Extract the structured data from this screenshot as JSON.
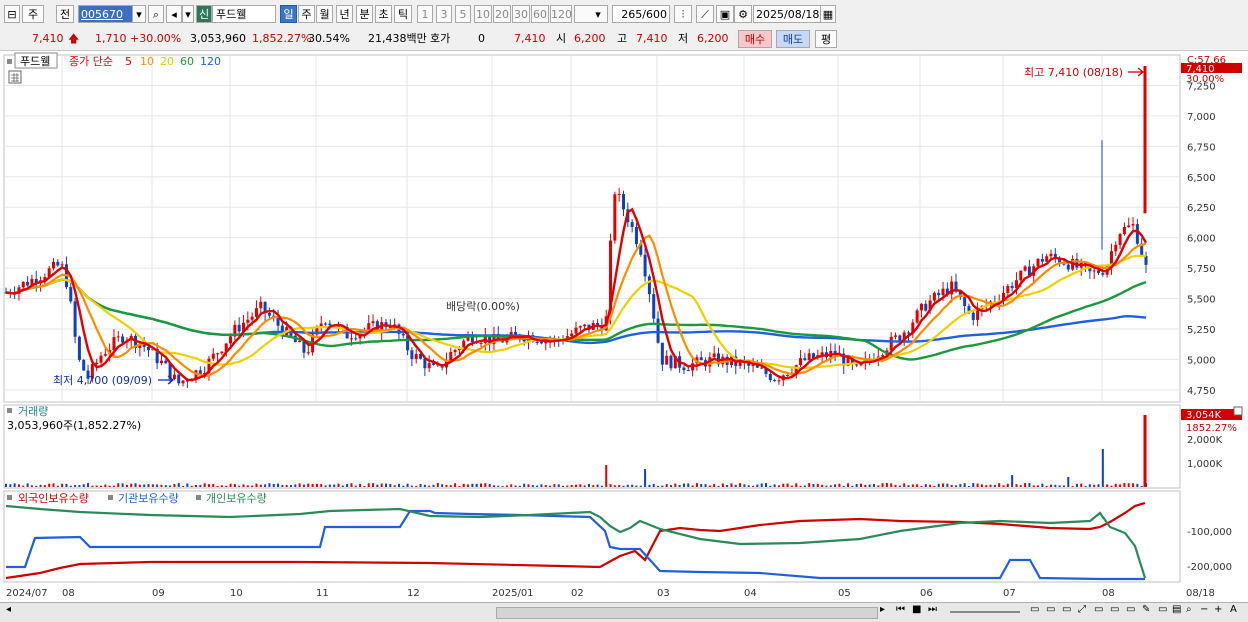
{
  "toolbar": {
    "market": "주",
    "prev_label": "전",
    "stock_code": "005670",
    "new_badge": "신",
    "stock_name": "푸드웰",
    "periods": [
      "일",
      "주",
      "월",
      "년",
      "분",
      "초",
      "틱"
    ],
    "active_period": "일",
    "intervals": [
      "1",
      "3",
      "5",
      "10",
      "20",
      "30",
      "60",
      "120"
    ],
    "count": "265",
    "count_total": "/600",
    "date": "2025/08/18"
  },
  "quote": {
    "price": "7,410",
    "change": "1,710",
    "change_pct": "+30.00%",
    "volume": "3,053,960",
    "volume_ratio": "1,852.27%",
    "turnover": "30.54%",
    "amount": "21,438백만",
    "hoga_label": "호가",
    "hoga_value": "0",
    "hoga_price": "7,410",
    "open_label": "시",
    "open": "6,200",
    "high_label": "고",
    "high": "7,410",
    "low_label": "저",
    "low": "6,200",
    "buy_button": "매수",
    "sell_button": "매도",
    "eval_button": "평"
  },
  "legend": {
    "stock_tag": "푸드웰",
    "ma_prefix": "종가 단순",
    "ma_periods": [
      "5",
      "10",
      "20",
      "60",
      "120"
    ],
    "ma_colors": [
      "#e00000",
      "#ff8c00",
      "#f0d000",
      "#1a9a3a",
      "#2060e0"
    ]
  },
  "annotations": {
    "high_label": "최고 7,410 (08/18)",
    "low_label": "최저 4,700 (09/09)",
    "dividend_label": "배당락(0.00%)"
  },
  "axis": {
    "price_ticks": [
      "7,250",
      "7,000",
      "6,750",
      "6,500",
      "6,250",
      "6,000",
      "5,750",
      "5,500",
      "5,250",
      "5,000",
      "4,750"
    ],
    "top_label": "C:57.66",
    "last_price_tag": "7,410",
    "last_pct_tag": "30.00%",
    "volume_ticks": [
      "2,000K",
      "1,000K"
    ],
    "volume_tag": "3,054K",
    "volume_pct_tag": "1852.27%",
    "holding_ticks": [
      "-100,000",
      "-200,000"
    ],
    "x_labels": [
      "2024/07",
      "08",
      "09",
      "10",
      "11",
      "12",
      "2025/01",
      "02",
      "03",
      "04",
      "05",
      "06",
      "07",
      "08",
      "08/18"
    ]
  },
  "volume_panel": {
    "title": "거래량",
    "info": "3,053,960주(1,852.27%)"
  },
  "holdings_panel": {
    "series": [
      "외국인보유수량",
      "기관보유수량",
      "개인보유수량"
    ],
    "colors": [
      "#d00000",
      "#2060e0",
      "#2a8a5a"
    ]
  },
  "colors": {
    "up": "#e00000",
    "down": "#1040c0"
  },
  "chart_data": {
    "type": "candlestick",
    "price_range": [
      4650,
      7500
    ],
    "close_series": [
      {
        "period": "2024/07",
        "close": 5550
      },
      {
        "period": "2024/08 early",
        "close": 5780
      },
      {
        "period": "2024/08 mid",
        "close": 4950
      },
      {
        "period": "2024/09",
        "close": 4800
      },
      {
        "period": "2024/10",
        "close": 5350
      },
      {
        "period": "2024/11",
        "close": 5300
      },
      {
        "period": "2024/12",
        "close": 4950
      },
      {
        "period": "2025/01",
        "close": 5200
      },
      {
        "period": "2025/02 mid",
        "close": 6300
      },
      {
        "period": "2025/03",
        "close": 4950
      },
      {
        "period": "2025/04",
        "close": 4900
      },
      {
        "period": "2025/05",
        "close": 4950
      },
      {
        "period": "2025/06",
        "close": 5550
      },
      {
        "period": "2025/07",
        "close": 5850
      },
      {
        "period": "2025/08 mid",
        "close": 5800
      },
      {
        "period": "2025/08/18",
        "close": 7410
      }
    ],
    "ma60_approx": [
      5650,
      5250,
      5150,
      5100,
      5150,
      5100,
      5250,
      5200,
      5150,
      5150,
      5650
    ],
    "ma120_approx": [
      5050,
      5200,
      5300,
      5300,
      5200,
      5200,
      5200,
      5150,
      5250,
      5350
    ]
  }
}
